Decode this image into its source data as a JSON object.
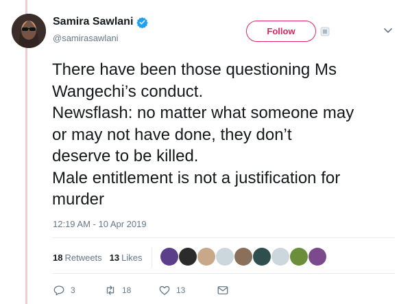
{
  "author": {
    "name": "Samira Sawlani",
    "handle": "@samirasawlani",
    "verified_icon": "verified-badge-icon"
  },
  "follow_label": "Follow",
  "tweet": {
    "text": "There have been those questioning Ms\nWangechi’s conduct.\nNewsflash: no matter what someone may\nor may not have done, they don’t\ndeserve to be killed.\nMale entitlement is not a justification for\nmurder",
    "timestamp": "12:19 AM - 10 Apr 2019"
  },
  "stats": {
    "retweets_count": "18",
    "retweets_label": "Retweets",
    "likes_count": "13",
    "likes_label": "Likes"
  },
  "liker_colors": [
    "#5b3f8a",
    "#2b2b2b",
    "#c9a889",
    "#ccd6dd",
    "#8a6f5a",
    "#2f4f4f",
    "#ccd6dd",
    "#6b8e3a",
    "#7a4a8a"
  ],
  "actions": {
    "reply_count": "3",
    "retweet_count": "18",
    "like_count": "13"
  },
  "colors": {
    "accent": "#e0245e",
    "secondary_text": "#657786",
    "verified": "#1da1f2"
  }
}
